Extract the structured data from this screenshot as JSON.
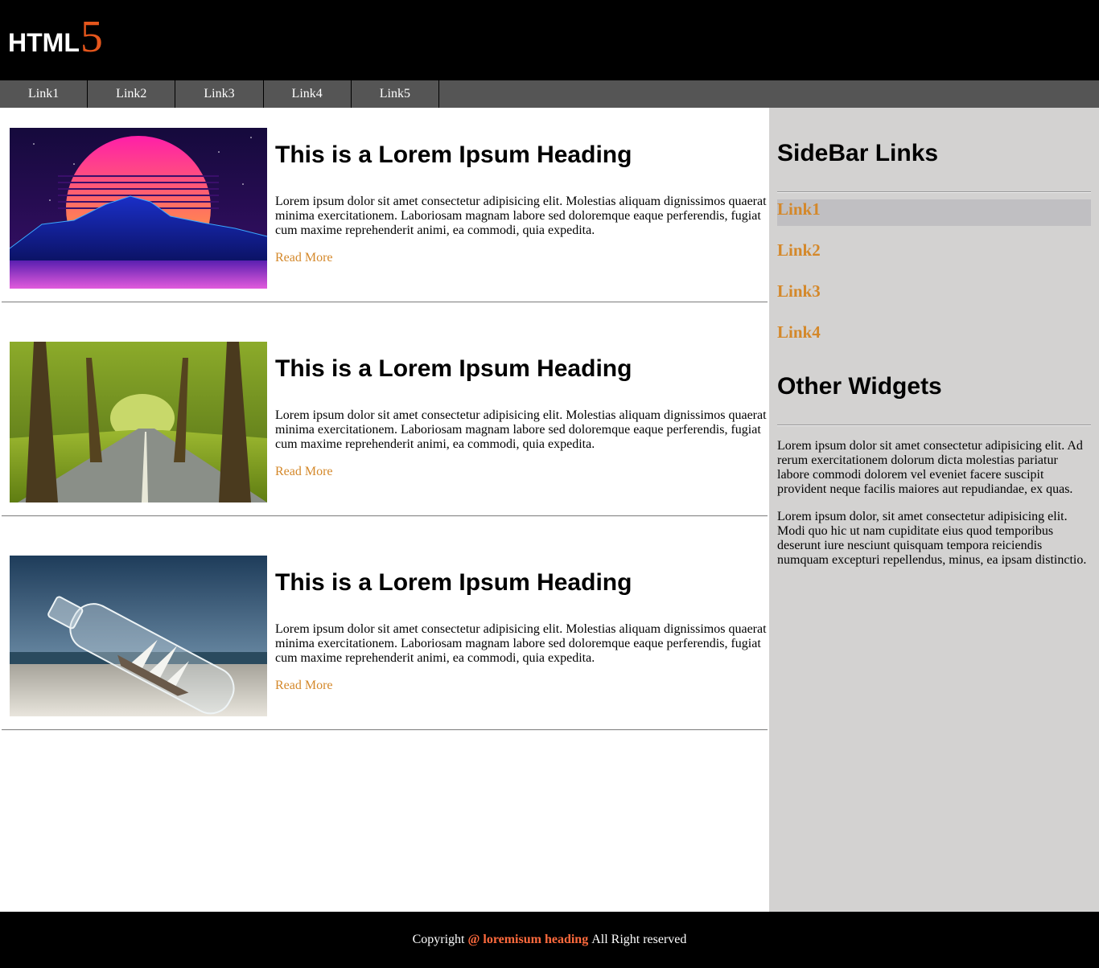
{
  "header": {
    "logo_text": "HTML",
    "logo_number": "5"
  },
  "nav": {
    "items": [
      "Link1",
      "Link2",
      "Link3",
      "Link4",
      "Link5"
    ]
  },
  "posts": [
    {
      "image": "synthwave-sunset-mountains-image",
      "title": "This is a Lorem Ipsum Heading",
      "body": "Lorem ipsum dolor sit amet consectetur adipisicing elit. Molestias aliquam dignissimos quaerat minima exercitationem. Laboriosam magnam labore sed doloremque eaque perferendis, fugiat cum maxime reprehenderit animi, ea commodi, quia expedita.",
      "read_more": "Read More"
    },
    {
      "image": "forest-road-image",
      "title": "This is a Lorem Ipsum Heading",
      "body": "Lorem ipsum dolor sit amet consectetur adipisicing elit. Molestias aliquam dignissimos quaerat minima exercitationem. Laboriosam magnam labore sed doloremque eaque perferendis, fugiat cum maxime reprehenderit animi, ea commodi, quia expedita.",
      "read_more": "Read More"
    },
    {
      "image": "ship-in-bottle-beach-image",
      "title": "This is a Lorem Ipsum Heading",
      "body": "Lorem ipsum dolor sit amet consectetur adipisicing elit. Molestias aliquam dignissimos quaerat minima exercitationem. Laboriosam magnam labore sed doloremque eaque perferendis, fugiat cum maxime reprehenderit animi, ea commodi, quia expedita.",
      "read_more": "Read More"
    }
  ],
  "sidebar": {
    "links_heading": "SideBar Links",
    "links": [
      "Link1",
      "Link2",
      "Link3",
      "Link4"
    ],
    "active_link": "Link1",
    "widgets_heading": "Other Widgets",
    "paragraphs": [
      "Lorem ipsum dolor sit amet consectetur adipisicing elit. Ad rerum exercitationem dolorum dicta molestias pariatur labore commodi dolorem vel eveniet facere suscipit provident neque facilis maiores aut repudiandae, ex quas.",
      "Lorem ipsum dolor, sit amet consectetur adipisicing elit. Modi quo hic ut nam cupiditate eius quod temporibus deserunt iure nesciunt quisquam tempora reiciendis numquam excepturi repellendus, minus, ea ipsam distinctio."
    ]
  },
  "footer": {
    "prefix": "Copyright",
    "brand": "@ loremisum heading",
    "suffix": "All Right reserved"
  },
  "colors": {
    "header_bg": "#000000",
    "nav_bg": "#555555",
    "sidebar_bg": "#d3d2d1",
    "accent_link": "#d4882a",
    "logo_accent": "#e5561c",
    "footer_brand": "#ff6a3d"
  }
}
